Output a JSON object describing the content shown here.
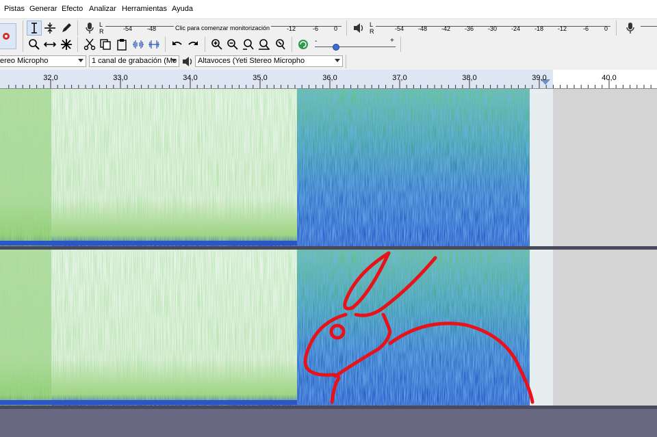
{
  "menu": {
    "items": [
      "Pistas",
      "Generar",
      "Efecto",
      "Analizar",
      "Herramientas",
      "Ayuda"
    ]
  },
  "record_meter": {
    "channels": [
      "L",
      "R"
    ],
    "ticks": [
      "-54",
      "-48",
      "-12",
      "-6",
      "0"
    ],
    "prompt": "Clic para comenzar monitorización"
  },
  "playback_meter": {
    "channels": [
      "L",
      "R"
    ],
    "ticks": [
      "-54",
      "-48",
      "-42",
      "-36",
      "-30",
      "-24",
      "-18",
      "-12",
      "-6",
      "0"
    ]
  },
  "device": {
    "recording_device": "ereo Microphо",
    "channels": "1 canal de grabación (Mo",
    "playback_device": "Altavoces (Yeti Stereo Micropho"
  },
  "speed_slider": {
    "min_label": "-",
    "max_label": "+",
    "value": 0.25
  },
  "ruler": {
    "labels": [
      "32,0",
      "33,0",
      "34,0",
      "35,0",
      "36,0",
      "37,0",
      "38,0",
      "39,0",
      "40,0"
    ]
  },
  "colors": {
    "annotation": "#e8121b",
    "spectrogram_high": "#2a52c9",
    "spectrogram_mid": "#5bb86a",
    "spectrogram_low": "#e9f6ec",
    "track_background": "#686882",
    "selection": "#dfe6f3"
  }
}
